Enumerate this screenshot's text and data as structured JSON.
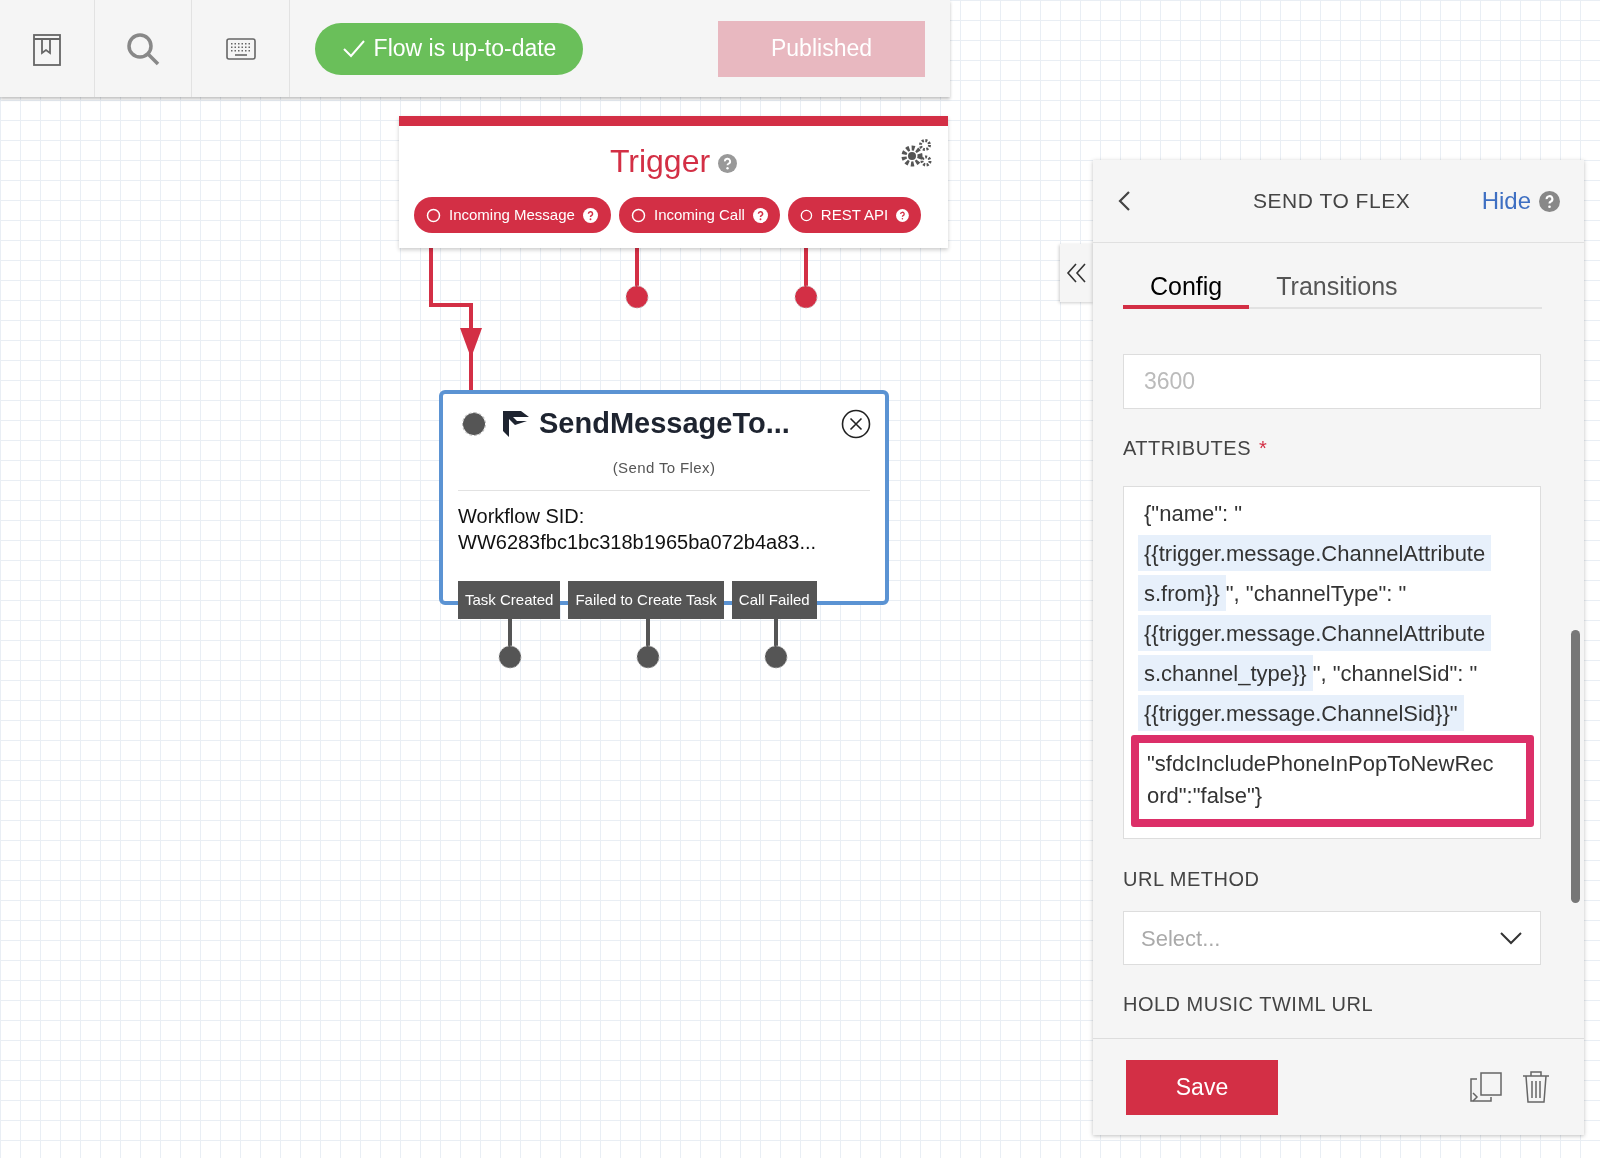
{
  "toolbar": {
    "status": "Flow is up-to-date",
    "publish_button": {
      "label": "Published",
      "disabled": true
    }
  },
  "trigger": {
    "title": "Trigger",
    "chips": [
      {
        "label": "Incoming Message"
      },
      {
        "label": "Incoming Call"
      },
      {
        "label": "REST API"
      }
    ]
  },
  "node": {
    "title": "SendMessageTo...",
    "subtitle": "(Send To Flex)",
    "field_label": "Workflow SID:",
    "field_value": "WW6283fbc1bc318b1965ba072b4a83...",
    "transitions": [
      "Task Created",
      "Failed to Create Task",
      "Call Failed"
    ]
  },
  "panel": {
    "title": "SEND TO FLEX",
    "hide_link": "Hide",
    "tabs": [
      {
        "label": "Config",
        "selected": true
      },
      {
        "label": "Transitions",
        "selected": false
      }
    ],
    "timeout_field": {
      "placeholder": "3600"
    },
    "attributes": {
      "label": "ATTRIBUTES",
      "required_mark": "*",
      "lines": [
        [
          {
            "text": "{\"name\": \"",
            "highlight": false
          }
        ],
        [
          {
            "text": "{{trigger.message.ChannelAttribute",
            "highlight": true
          }
        ],
        [
          {
            "text": "s.from}}",
            "highlight": true
          },
          {
            "text": "\", \"channelType\": \"",
            "highlight": false
          }
        ],
        [
          {
            "text": "{{trigger.message.ChannelAttribute",
            "highlight": true
          }
        ],
        [
          {
            "text": "s.channel_type}}",
            "highlight": true
          },
          {
            "text": "\", \"channelSid\": \"",
            "highlight": false
          }
        ],
        [
          {
            "text": "{{trigger.message.ChannelSid}}\"",
            "highlight": true
          }
        ]
      ],
      "marked_lines": [
        "\"sfdcIncludePhoneInPopToNewRec",
        "ord\":\"false\"}"
      ]
    },
    "url_method": {
      "label": "URL METHOD",
      "placeholder": "Select..."
    },
    "hold_music_label": "HOLD MUSIC TWIML URL",
    "save_button": "Save"
  }
}
